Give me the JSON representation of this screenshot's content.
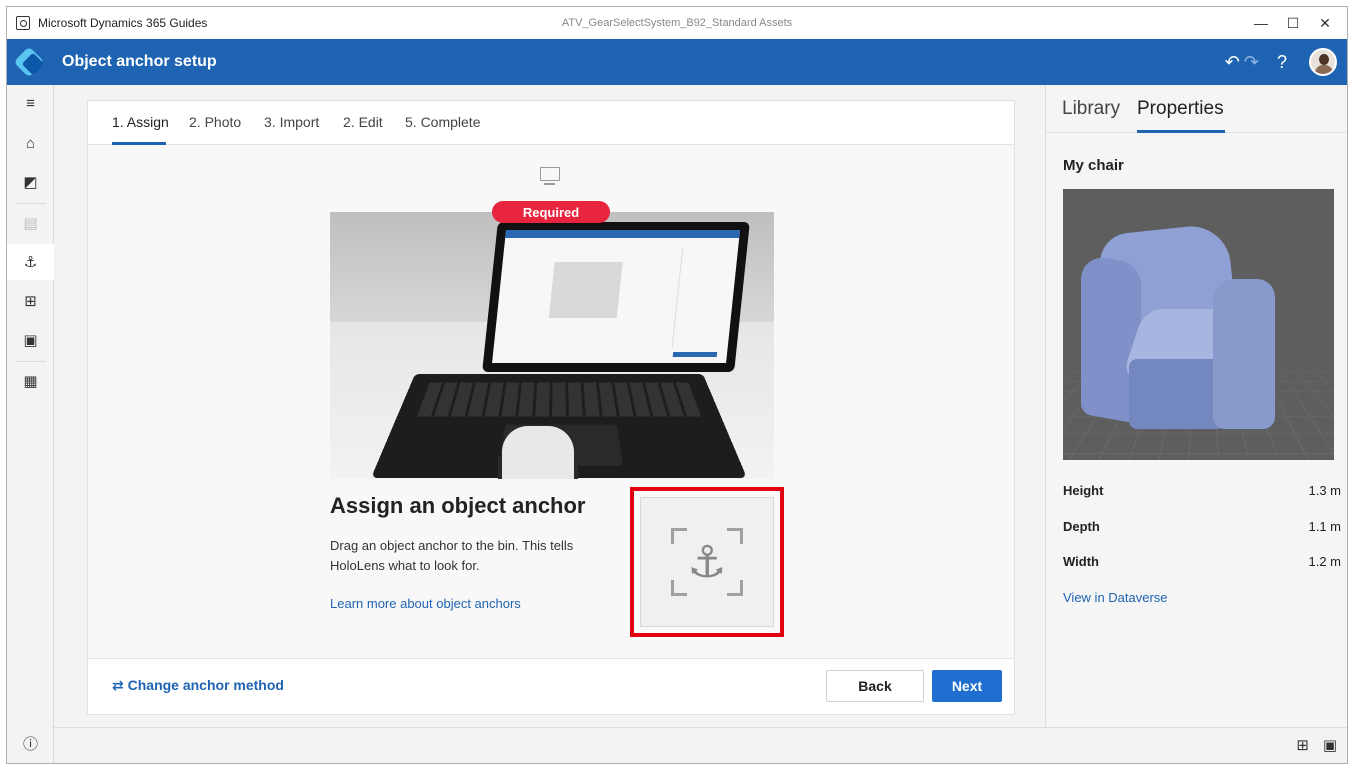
{
  "titlebar": {
    "app_name": "Microsoft Dynamics 365 Guides",
    "document_name": "ATV_GearSelectSystem_B92_Standard Assets",
    "minimize": "—",
    "maximize": "☐",
    "close": "✕"
  },
  "header": {
    "title": "Object anchor setup",
    "undo": "↶",
    "redo": "↷",
    "help": "?"
  },
  "rail": {
    "menu": "≡",
    "home": "⌂",
    "analytics": "◩",
    "content": "▤",
    "anchor": "⚓",
    "grid": "⊞",
    "layout": "▣",
    "save": "▦",
    "info": "ⓘ"
  },
  "wizard": {
    "steps": [
      "1. Assign",
      "2. Photo",
      "3. Import",
      "2. Edit",
      "5. Complete"
    ],
    "required_badge": "Required",
    "heading": "Assign an object anchor",
    "description": "Drag an object anchor to the bin. This tells HoloLens what to look for.",
    "learn_more": "Learn more about object anchors",
    "anchor_glyph": "⚓",
    "change_method": "⇄ Change anchor method",
    "back": "Back",
    "next": "Next"
  },
  "panel": {
    "tabs": [
      "Library",
      "Properties"
    ],
    "active_tab": "Properties",
    "object_name": "My chair",
    "properties": [
      {
        "label": "Height",
        "value": "1.3 m"
      },
      {
        "label": "Depth",
        "value": "1.1 m"
      },
      {
        "label": "Width",
        "value": "1.2 m"
      }
    ],
    "dataverse_link": "View in Dataverse"
  },
  "bottombar": {
    "grid_view": "⊞",
    "card_view": "▣"
  },
  "colors": {
    "header": "#1f64b2",
    "accent": "#1f64b2",
    "required": "#e8243e",
    "highlight_box": "#e3000f",
    "primary_button": "#1f6fd1"
  }
}
